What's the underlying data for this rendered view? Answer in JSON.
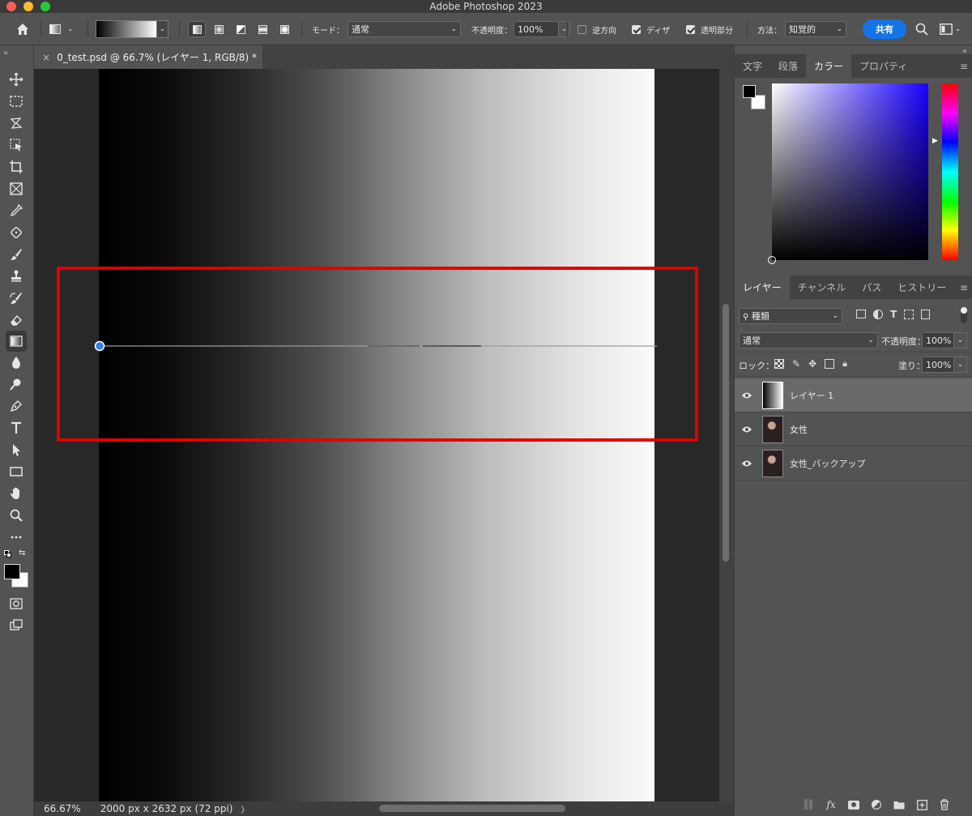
{
  "app": {
    "title": "Adobe Photoshop 2023"
  },
  "options_bar": {
    "mode_label": "モード：",
    "mode_value": "通常",
    "opacity_label": "不透明度：",
    "opacity_value": "100%",
    "reverse_label": "逆方向",
    "reverse_checked": false,
    "dither_label": "ディザ",
    "dither_checked": true,
    "transparency_label": "透明部分",
    "transparency_checked": true,
    "method_label": "方法：",
    "method_value": "知覚的",
    "share_label": "共有"
  },
  "document_tab": {
    "close_glyph": "×",
    "title": "0_test.psd @ 66.7% (レイヤー 1, RGB/8) *"
  },
  "status_bar": {
    "zoom": "66.67%",
    "doc_info": "2000 px x 2632 px (72 ppi)",
    "arrow": "〉"
  },
  "color_panel": {
    "tabs": [
      "文字",
      "段落",
      "カラー",
      "プロパティ"
    ],
    "active_tab": "カラー",
    "picker_hue": "#1a00ff"
  },
  "layers_panel": {
    "tabs": [
      "レイヤー",
      "チャンネル",
      "パス",
      "ヒストリー"
    ],
    "active_tab": "レイヤー",
    "filter_label": "種類",
    "blend_mode": "通常",
    "opacity_label": "不透明度：",
    "opacity_value": "100%",
    "lock_label": "ロック：",
    "fill_label": "塗り：",
    "fill_value": "100%",
    "layers": [
      {
        "name": "レイヤー 1",
        "active": true,
        "visible": true
      },
      {
        "name": "女性",
        "active": false,
        "visible": true
      },
      {
        "name": "女性_バックアップ",
        "active": false,
        "visible": true
      }
    ]
  },
  "toolbar": {
    "tools": [
      "move-tool-icon",
      "marquee-tool-icon",
      "lasso-tool-icon",
      "object-select-icon",
      "crop-tool-icon",
      "frame-tool-icon",
      "eyedropper-icon",
      "healing-brush-icon",
      "brush-tool-icon",
      "clone-stamp-icon",
      "history-brush-icon",
      "eraser-icon",
      "gradient-tool-icon",
      "blur-tool-icon",
      "dodge-tool-icon",
      "pen-tool-icon",
      "type-tool-icon",
      "path-select-icon",
      "rectangle-tool-icon",
      "hand-tool-icon",
      "zoom-tool-icon",
      "more-tools-icon"
    ],
    "foreground_color": "#000000",
    "background_color": "#ffffff",
    "active_tool": "gradient-tool-icon"
  },
  "highlight": {
    "color": "#e00000"
  }
}
